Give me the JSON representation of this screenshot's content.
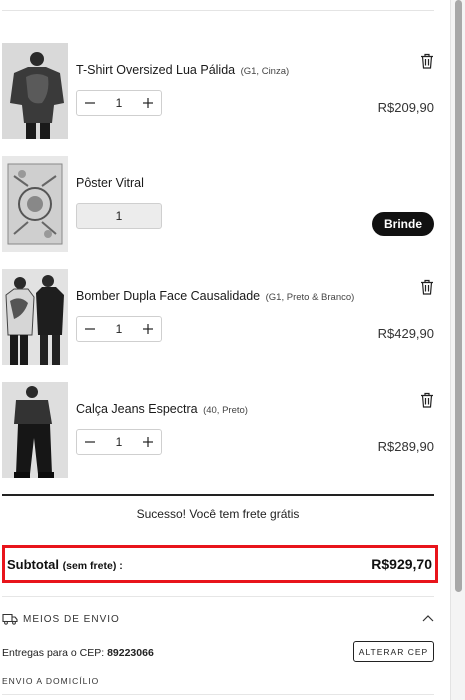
{
  "cart": {
    "items": [
      {
        "title": "T-Shirt Oversized Lua Pálida",
        "variant": "(G1, Cinza)",
        "quantity": "1",
        "price": "R$209,90",
        "minus_icon": "minus-icon",
        "plus_icon": "plus-icon",
        "remove_icon": "trash-icon"
      },
      {
        "title": "Pôster Vitral",
        "variant": "",
        "quantity": "1",
        "badge": "Brinde"
      },
      {
        "title": "Bomber Dupla Face Causalidade",
        "variant": "(G1, Preto & Branco)",
        "quantity": "1",
        "price": "R$429,90",
        "minus_icon": "minus-icon",
        "plus_icon": "plus-icon",
        "remove_icon": "trash-icon"
      },
      {
        "title": "Calça Jeans Espectra",
        "variant": "(40, Preto)",
        "quantity": "1",
        "price": "R$289,90",
        "minus_icon": "minus-icon",
        "plus_icon": "plus-icon",
        "remove_icon": "trash-icon"
      }
    ],
    "free_shipping_message": "Sucesso! Você tem frete grátis",
    "subtotal": {
      "label": "Subtotal",
      "note": "(sem frete) :",
      "value": "R$929,70",
      "highlight_color": "#e8141b"
    }
  },
  "shipping": {
    "title": "MEIOS DE ENVIO",
    "icon": "truck-icon",
    "toggle_icon": "chevron-up-icon",
    "cep_label": "Entregas para o CEP:",
    "cep_value": "89223066",
    "change_button": "ALTERAR CEP",
    "method_label": "ENVIO A DOMICÍLIO"
  },
  "colors": {
    "accent_dark": "#111111",
    "highlight": "#e8141b"
  }
}
